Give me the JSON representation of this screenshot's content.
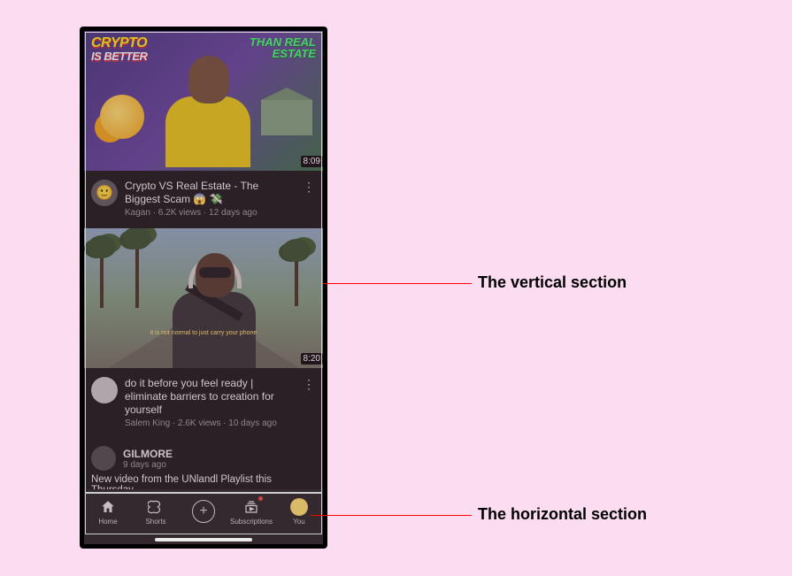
{
  "annotations": {
    "vertical_label": "The vertical section",
    "horizontal_label": "The horizontal section"
  },
  "videos": [
    {
      "thumb_text_left_line1": "CRYPTO",
      "thumb_text_left_line2": "IS BETTER",
      "thumb_text_right_line1": "THAN REAL",
      "thumb_text_right_line2": "ESTATE",
      "duration": "8:09",
      "title": "Crypto VS Real Estate - The Biggest Scam 😱 💸",
      "subline": "Kagan · 6.2K views · 12 days ago"
    },
    {
      "caption": "it is not normal to just carry your phone",
      "duration": "8:20",
      "title": "do it before you feel ready | eliminate barriers to creation for yourself",
      "subline": "Salem King · 2.6K views · 10 days ago"
    }
  ],
  "post": {
    "author": "GILMORE",
    "time": "9 days ago",
    "text": "New video from the UNlandl Playlist this Thursday"
  },
  "nav": {
    "home": "Home",
    "shorts": "Shorts",
    "create_symbol": "+",
    "subscriptions": "Subscriptions",
    "you": "You"
  }
}
